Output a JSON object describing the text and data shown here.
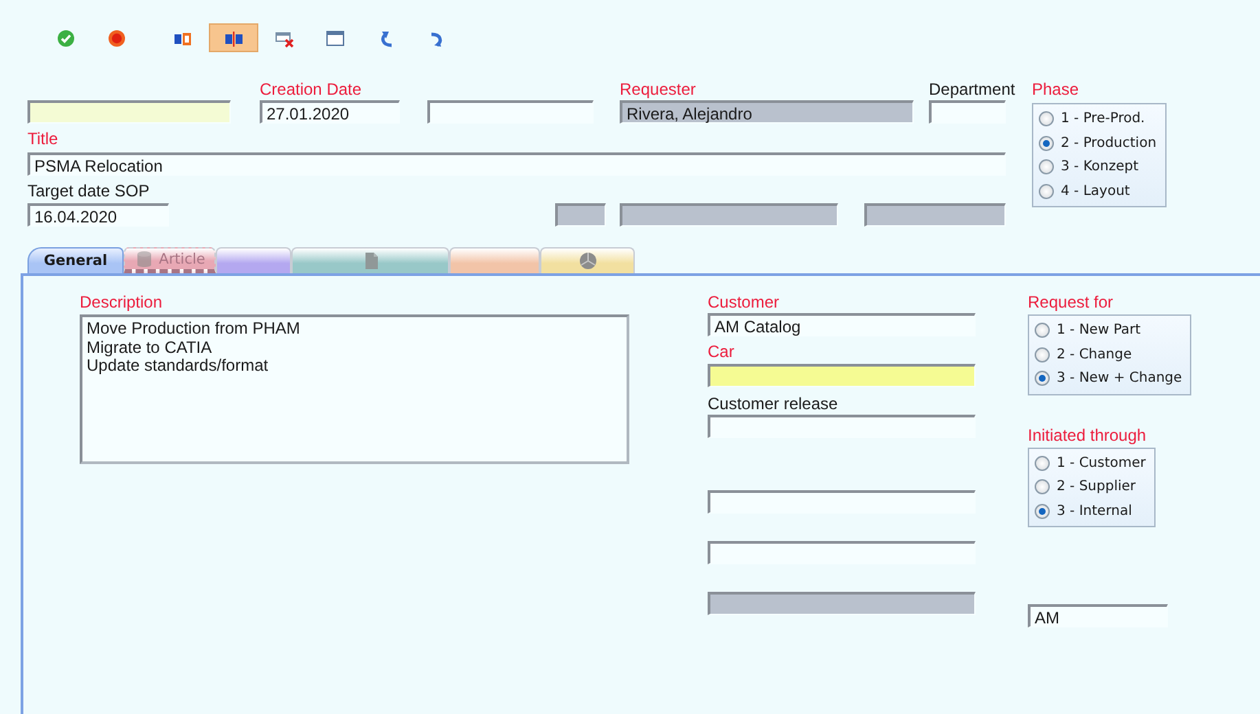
{
  "toolbar": [
    {
      "selected": false
    },
    {
      "selected": false
    },
    {
      "selected": false
    },
    {
      "selected": true
    },
    {
      "selected": false
    },
    {
      "selected": false
    },
    {
      "selected": false
    },
    {
      "selected": false
    }
  ],
  "header": {
    "creation_date": {
      "label": "Creation Date",
      "required": true,
      "value": "27.01.2020"
    },
    "requester": {
      "label": "Requester",
      "required": true,
      "value": "Rivera, Alejandro"
    },
    "department": {
      "label": "Department",
      "required": false
    },
    "title": {
      "label": "Title",
      "required": true,
      "value": "PSMA Relocation"
    },
    "target_date_sop": {
      "label": "Target date SOP",
      "required": false,
      "value": "16.04.2020"
    },
    "phase": {
      "label": "Phase",
      "required": true,
      "options": [
        {
          "label": "1 - Pre-Prod.",
          "selected": false
        },
        {
          "label": "2 - Production",
          "selected": true
        },
        {
          "label": "3 - Konzept",
          "selected": false
        },
        {
          "label": "4 - Layout",
          "selected": false
        }
      ]
    }
  },
  "tabs": [
    {
      "label": "General",
      "selected": true,
      "disabled": false,
      "color": "#a9c4f5"
    },
    {
      "label": "Article",
      "selected": false,
      "disabled": true,
      "color": "#e8a8b4"
    },
    {
      "selected": false,
      "disabled": false,
      "color": "#b4a8f0"
    },
    {
      "selected": false,
      "disabled": false,
      "color": "#98c8c8"
    },
    {
      "selected": false,
      "disabled": false,
      "color": "#f2c4a8"
    },
    {
      "selected": false,
      "disabled": false,
      "color": "#f2e0a0"
    }
  ],
  "general": {
    "description": {
      "label": "Description",
      "required": true,
      "value": "Move Production from PHAM\nMigrate to CATIA\nUpdate standards/format"
    },
    "customer": {
      "label": "Customer",
      "required": true,
      "value": "AM Catalog"
    },
    "car": {
      "label": "Car",
      "required": true
    },
    "customer_release": {
      "label": "Customer release",
      "required": false
    },
    "request_for": {
      "label": "Request for",
      "required": true,
      "options": [
        {
          "label": "1 - New Part",
          "selected": false
        },
        {
          "label": "2 - Change",
          "selected": false
        },
        {
          "label": "3 - New + Change",
          "selected": true
        }
      ]
    },
    "initiated_through": {
      "label": "Initiated through",
      "required": true,
      "options": [
        {
          "label": "1 - Customer",
          "selected": false
        },
        {
          "label": "2 - Supplier",
          "selected": false
        },
        {
          "label": "3 - Internal",
          "selected": true
        }
      ]
    },
    "unlabeled_field": {
      "value": "AM"
    }
  }
}
